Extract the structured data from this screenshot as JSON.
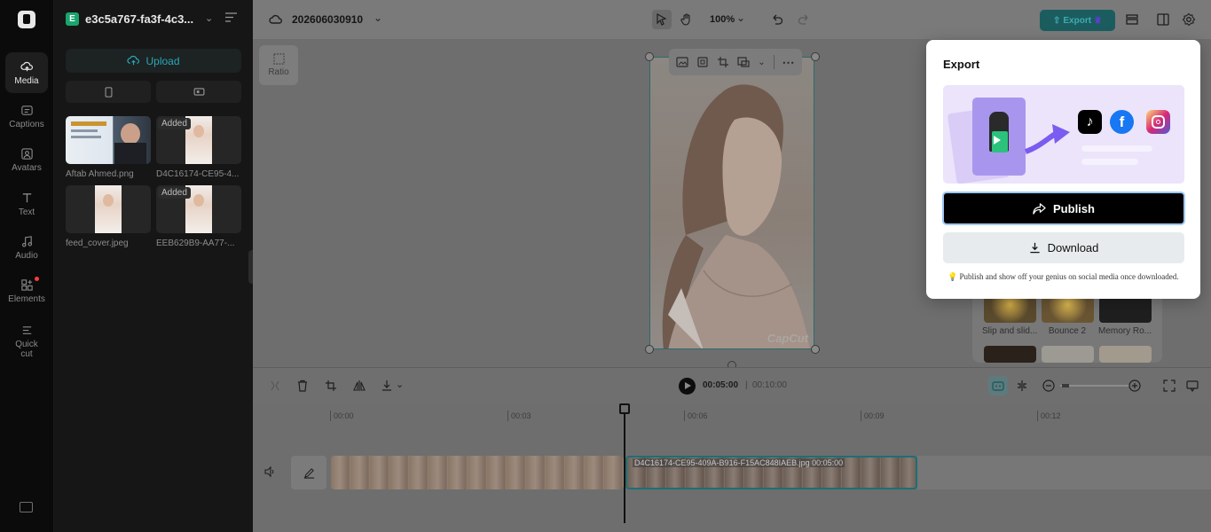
{
  "rail": {
    "items": [
      {
        "label": "Media",
        "icon": "cloud-media-icon"
      },
      {
        "label": "Captions",
        "icon": "captions-icon"
      },
      {
        "label": "Avatars",
        "icon": "avatar-icon"
      },
      {
        "label": "Text",
        "icon": "text-icon"
      },
      {
        "label": "Audio",
        "icon": "music-note-icon"
      },
      {
        "label": "Elements",
        "icon": "elements-icon"
      },
      {
        "label": "Quick",
        "label2": "cut",
        "icon": "quick-cut-icon"
      }
    ]
  },
  "panel": {
    "badge": "E",
    "project_name": "e3c5a767-fa3f-4c3...",
    "upload_label": "Upload",
    "media": [
      {
        "name": "Aftab Ahmed.png",
        "added": ""
      },
      {
        "name": "D4C16174-CE95-4...",
        "added": "Added"
      },
      {
        "name": "feed_cover.jpeg",
        "added": ""
      },
      {
        "name": "EEB629B9-AA77-...",
        "added": "Added"
      }
    ]
  },
  "topbar": {
    "title": "202606030910",
    "zoom": "100%",
    "export_label": "Export"
  },
  "stage": {
    "ratio_label": "Ratio",
    "watermark": "CapCut"
  },
  "playback": {
    "current": "00:05:00",
    "separator": "|",
    "total": "00:10:00"
  },
  "timeline": {
    "ticks": [
      "00:00",
      "00:03",
      "00:06",
      "00:09",
      "00:12"
    ],
    "clip2_label": "D4C16174-CE95-409A-B916-F15AC848IAEB.jpg  00:05:00"
  },
  "tray": {
    "items": [
      "Slip and slid...",
      "Bounce 2",
      "Memory Ro..."
    ]
  },
  "export": {
    "title": "Export",
    "publish_label": "Publish",
    "download_label": "Download",
    "tip_icon": "lightbulb-icon",
    "tip": "Publish and show off your genius on social media once downloaded."
  },
  "colors": {
    "accent": "#27a9b7",
    "publish_bg": "#000000",
    "banner_bg": "#ebe4fb",
    "tiktok": "#000000",
    "facebook": "#1877f2",
    "instagram": "#e1306c"
  }
}
